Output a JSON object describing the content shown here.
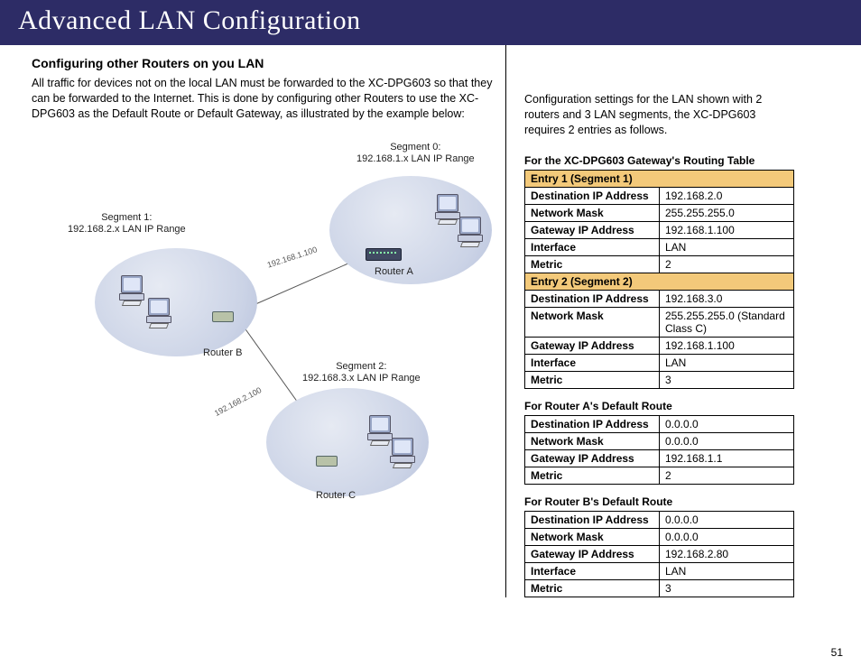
{
  "header": {
    "title": "Advanced LAN Configuration"
  },
  "left": {
    "heading": "Configuring other Routers on you LAN",
    "paragraph": "All traffic for devices not on the local LAN must be forwarded to the XC-DPG603 so that they can be forwarded to the Internet. This is done by configuring other Routers to use the XC-DPG603 as the Default Route or Default Gateway, as illustrated by the example below:"
  },
  "diagram": {
    "segment0_label": "Segment 0:\n192.168.1.x LAN IP Range",
    "segment1_label": "Segment 1:\n192.168.2.x LAN IP Range",
    "segment2_label": "Segment 2:\n192.168.3.x LAN IP Range",
    "routerA": "Router A",
    "routerB": "Router B",
    "routerC": "Router C",
    "line1_ip": "192.168.1.100",
    "line2_ip": "192.168.2.100"
  },
  "right": {
    "intro": "Configuration settings for the LAN shown with 2 routers and 3 LAN segments, the XC-DPG603 requires 2 entries as follows.",
    "t1": {
      "title": "For the XC-DPG603 Gateway's Routing Table",
      "e1_hdr": "Entry 1 (Segment 1)",
      "e1_dip_l": "Destination IP Address",
      "e1_dip_v": "192.168.2.0",
      "e1_nm_l": "Network Mask",
      "e1_nm_v": "255.255.255.0",
      "e1_gw_l": "Gateway IP Address",
      "e1_gw_v": "192.168.1.100",
      "e1_if_l": "Interface",
      "e1_if_v": "LAN",
      "e1_m_l": "Metric",
      "e1_m_v": "2",
      "e2_hdr": "Entry 2 (Segment 2)",
      "e2_dip_l": "Destination IP Address",
      "e2_dip_v": "192.168.3.0",
      "e2_nm_l": "Network Mask",
      "e2_nm_v": "255.255.255.0 (Standard Class C)",
      "e2_gw_l": "Gateway IP Address",
      "e2_gw_v": "192.168.1.100",
      "e2_if_l": "Interface",
      "e2_if_v": "LAN",
      "e2_m_l": "Metric",
      "e2_m_v": "3"
    },
    "t2": {
      "title": "For Router A's Default Route",
      "dip_l": "Destination IP Address",
      "dip_v": "0.0.0.0",
      "nm_l": "Network Mask",
      "nm_v": "0.0.0.0",
      "gw_l": "Gateway IP Address",
      "gw_v": "192.168.1.1",
      "m_l": "Metric",
      "m_v": "2"
    },
    "t3": {
      "title": "For Router B's Default Route",
      "dip_l": "Destination IP Address",
      "dip_v": "0.0.0.0",
      "nm_l": "Network Mask",
      "nm_v": "0.0.0.0",
      "gw_l": "Gateway IP Address",
      "gw_v": "192.168.2.80",
      "if_l": "Interface",
      "if_v": "LAN",
      "m_l": "Metric",
      "m_v": "3"
    }
  },
  "page_number": "51"
}
